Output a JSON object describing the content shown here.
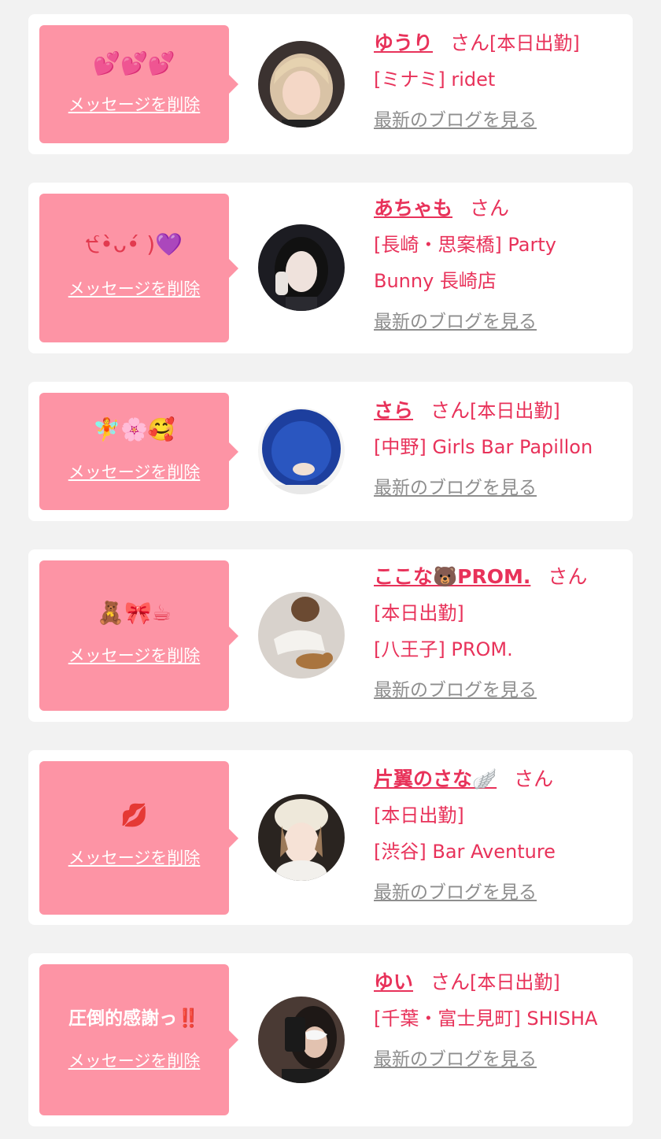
{
  "delete_label": "メッセージを削除",
  "blog_label": "最新のブログを見る",
  "san_label": "さん",
  "cards": [
    {
      "message": "💕💕💕",
      "name": "ゆうり",
      "tag": "[本日出勤]",
      "shop": "[ミナミ] ridet",
      "avatar_icon": "avatar-blonde-hair-icon"
    },
    {
      "message": "੯•̀ᴗ•́ )💜",
      "name": "あちゃも",
      "tag": "",
      "shop": "[長崎・思案橋] Party Bunny 長崎店",
      "avatar_icon": "avatar-dark-hair-icon"
    },
    {
      "message": "🧚🌸🥰",
      "name": "さら",
      "tag": "[本日出勤]",
      "shop": "[中野] Girls Bar Papillon",
      "avatar_icon": "avatar-blue-chair-icon"
    },
    {
      "message": "🧸🎀☕",
      "name": "ここな🐻PROM.",
      "tag": "[本日出勤]",
      "shop": "[八王子] PROM.",
      "avatar_icon": "avatar-with-cat-icon"
    },
    {
      "message": "💋",
      "name": "片翼のさな🪽",
      "tag": "[本日出勤]",
      "shop": "[渋谷] Bar Aventure",
      "avatar_icon": "avatar-beanie-icon"
    },
    {
      "message": "圧倒的感謝っ‼️",
      "name": "ゆい",
      "tag": "[本日出勤]",
      "shop": "[千葉・富士見町] SHISHA",
      "avatar_icon": "avatar-phone-selfie-icon"
    }
  ]
}
